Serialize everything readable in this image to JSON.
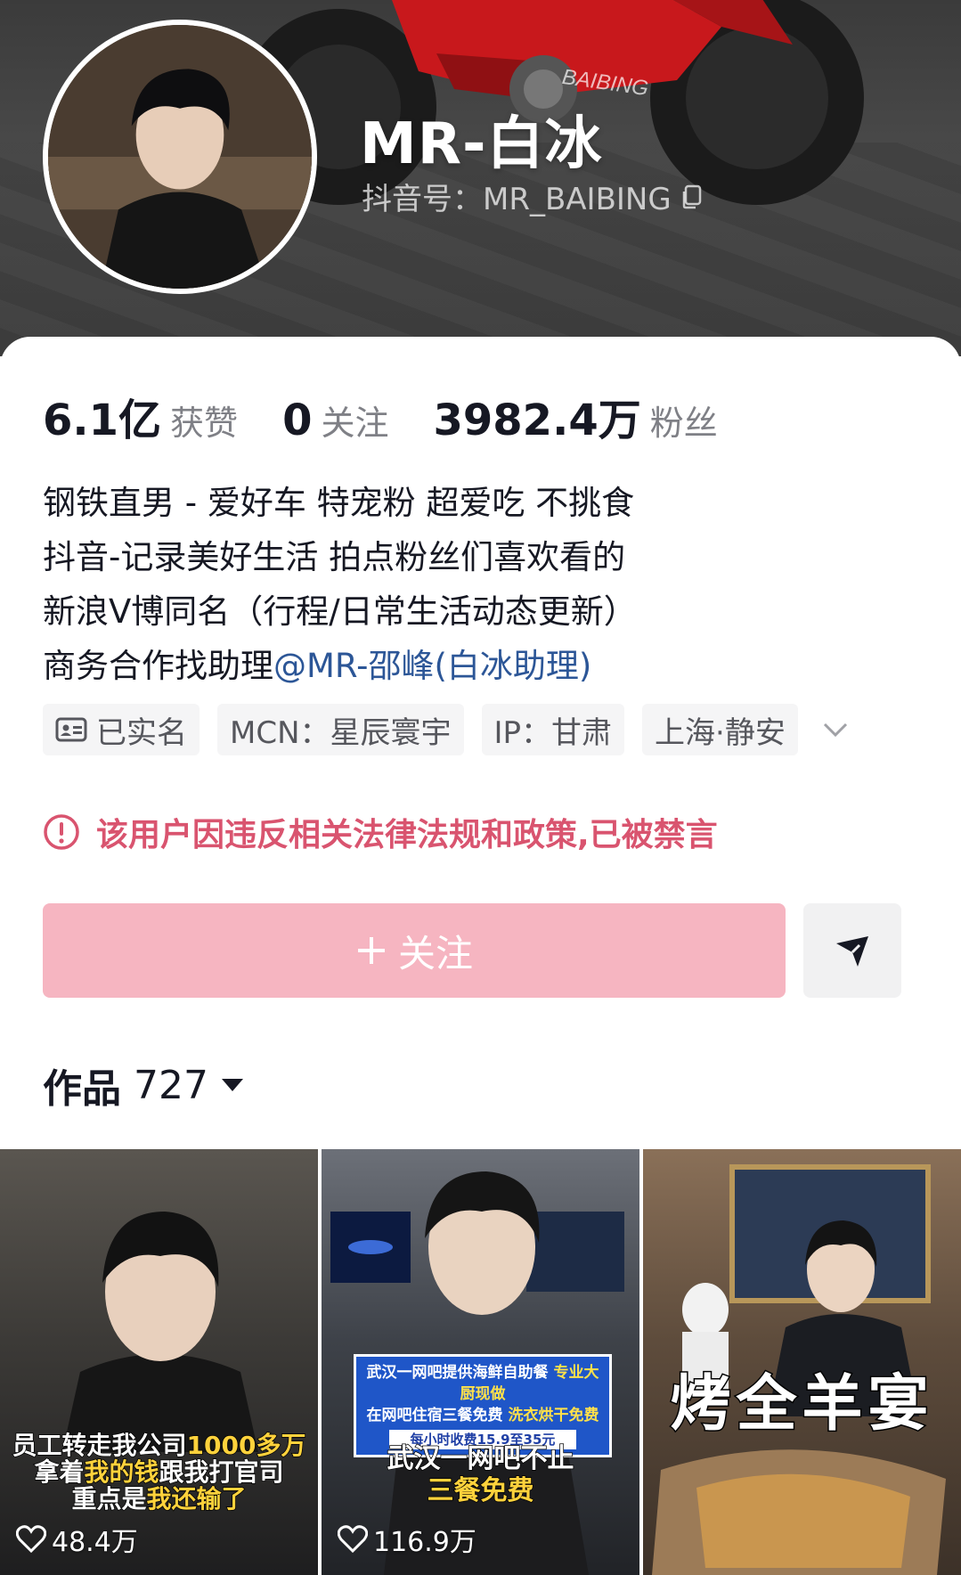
{
  "profile": {
    "name": "MR-白冰",
    "handle": "抖音号：MR_BAIBING",
    "bike_text": "BAIBING"
  },
  "stats": [
    {
      "value": "6.1亿",
      "label": "获赞"
    },
    {
      "value": "0",
      "label": "关注"
    },
    {
      "value": "3982.4万",
      "label": "粉丝"
    }
  ],
  "bio": {
    "line1": "钢铁直男 - 爱好车 特宠粉 超爱吃 不挑食",
    "line2": "抖音-记录美好生活 拍点粉丝们喜欢看的",
    "line3": "新浪V博同名（行程/日常生活动态更新）",
    "line4_prefix": "商务合作找助理",
    "line4_mention": "@MR-邵峰(白冰助理)"
  },
  "tags": {
    "verified": "已实名",
    "mcn": "MCN：星辰寰宇",
    "ip": "IP：甘肃",
    "location": "上海·静安"
  },
  "notice": "该用户因违反相关法律法规和政策,已被禁言",
  "actions": {
    "follow_label": "关注"
  },
  "works": {
    "label": "作品",
    "count": "727"
  },
  "videos": [
    {
      "caption_l1_a": "员工转走我公司",
      "caption_l1_b": "1000多万",
      "caption_l2_a": "拿着",
      "caption_l2_b": "我的钱",
      "caption_l2_c": "跟我打官司",
      "caption_l3_a": "重点是",
      "caption_l3_b": "我还输了",
      "likes": "48.4万"
    },
    {
      "news_l1": "武汉一网吧提供海鲜自助餐",
      "news_l1b": "专业大厨现做",
      "news_l2": "在网吧住宿三餐免费",
      "news_l2b": "洗衣烘干免费",
      "news_l3": "每小时收费15.9至35元",
      "caption_l1": "武汉一网吧不止",
      "caption_l2": "三餐免费",
      "likes": "116.9万"
    },
    {
      "caption": "烤全羊宴",
      "likes": ""
    }
  ],
  "colors": {
    "follow_bg": "#f6b5c1",
    "notice": "#d9546f",
    "mention": "#2c5697"
  }
}
